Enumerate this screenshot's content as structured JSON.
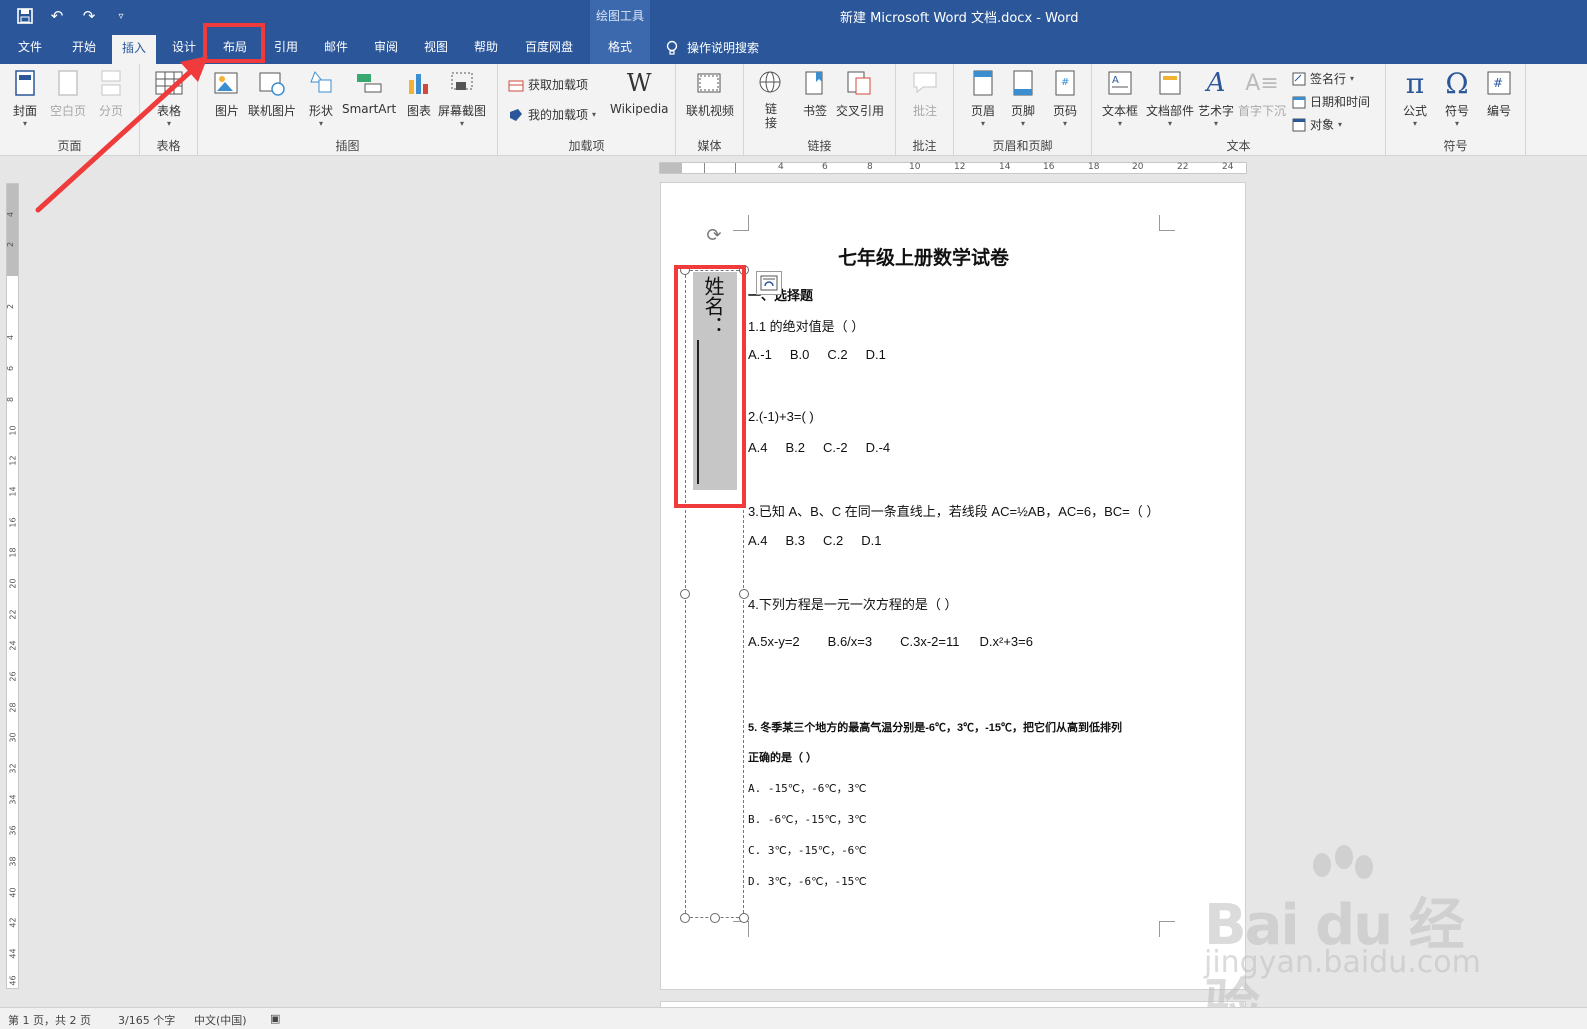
{
  "window": {
    "title": "新建 Microsoft Word 文档.docx  -  Word",
    "context_group": "绘图工具",
    "qat": {
      "save": "save-icon",
      "undo": "undo-icon",
      "redo": "redo-icon",
      "customize": "customize-icon"
    }
  },
  "tabs": [
    {
      "label": "文件"
    },
    {
      "label": "开始"
    },
    {
      "label": "插入"
    },
    {
      "label": "设计"
    },
    {
      "label": "布局"
    },
    {
      "label": "引用"
    },
    {
      "label": "邮件"
    },
    {
      "label": "审阅"
    },
    {
      "label": "视图"
    },
    {
      "label": "帮助"
    },
    {
      "label": "百度网盘"
    },
    {
      "label": "格式"
    }
  ],
  "tell_me": "操作说明搜索",
  "ribbon": {
    "groups": {
      "pages": "页面",
      "tables": "表格",
      "illustrations": "插图",
      "addins": "加载项",
      "media": "媒体",
      "links": "链接",
      "comments": "批注",
      "header_footer": "页眉和页脚",
      "text": "文本",
      "symbols": "符号"
    },
    "buttons": {
      "cover": "封面",
      "blank_page": "空白页",
      "page_break": "分页",
      "table": "表格",
      "picture": "图片",
      "online_picture": "联机图片",
      "shapes": "形状",
      "smartart": "SmartArt",
      "chart": "图表",
      "screenshot": "屏幕截图",
      "get_addins": "获取加载项",
      "my_addins": "我的加载项",
      "wikipedia": "Wikipedia",
      "online_video": "联机视频",
      "link": "链\n接",
      "bookmark": "书签",
      "cross_ref": "交叉引用",
      "comment": "批注",
      "header": "页眉",
      "footer": "页脚",
      "page_number": "页码",
      "textbox": "文本框",
      "quick_parts": "文档部件",
      "wordart": "艺术字",
      "drop_cap": "首字下沉",
      "signature": "签名行",
      "date_time": "日期和时间",
      "object": "对象",
      "equation": "公式",
      "symbol": "符号",
      "number": "编号"
    }
  },
  "ruler": {
    "h_labels": [
      "4",
      "6",
      "8",
      "10",
      "12",
      "14",
      "16",
      "18",
      "20",
      "22",
      "24"
    ],
    "v_labels": [
      "4",
      "2",
      "2",
      "4",
      "6",
      "8",
      "10",
      "12",
      "14",
      "16",
      "18",
      "20",
      "22",
      "24",
      "26",
      "28",
      "30",
      "32",
      "34",
      "36",
      "38",
      "40",
      "42",
      "44",
      "46"
    ]
  },
  "document": {
    "title": "七年级上册数学试卷",
    "section": "一、选择题",
    "textbox": "姓名：",
    "q1": "1.1 的绝对值是（    ）",
    "q1_opts": [
      "A.-1",
      "B.0",
      "C.2",
      "D.1"
    ],
    "q2": "2.(-1)+3=(    )",
    "q2_opts": [
      "A.4",
      "B.2",
      "C.-2",
      "D.-4"
    ],
    "q3": "3.已知 A、B、C 在同一条直线上，若线段 AC=½AB，AC=6，BC=（      ）",
    "q3_opts": [
      "A.4",
      "B.3",
      "C.2",
      "D.1"
    ],
    "q4": "4.下列方程是一元一次方程的是（      ）",
    "q4_opts": [
      "A.5x-y=2",
      "B.6/x=3",
      "C.3x-2=11",
      "D.x²+3=6"
    ],
    "q5": "5. 冬季某三个地方的最高气温分别是-6℃，3℃，-15℃，把它们从高到低排列",
    "q5_cont": "正确的是（      ）",
    "q5_opts": [
      "A. -15℃，-6℃，3℃",
      "B. -6℃，-15℃，3℃",
      "C. 3℃，-15℃，-6℃",
      "D. 3℃，-6℃，-15℃"
    ]
  },
  "status": {
    "page": "第 1 页，共 2 页",
    "words": "3/165 个字",
    "lang": "中文(中国)"
  },
  "watermark": {
    "main": "Bai du 经验",
    "sub": "jingyan.baidu.com"
  },
  "colors": {
    "ribbon_blue": "#2b579a",
    "highlight_red": "#ef3b3b"
  }
}
